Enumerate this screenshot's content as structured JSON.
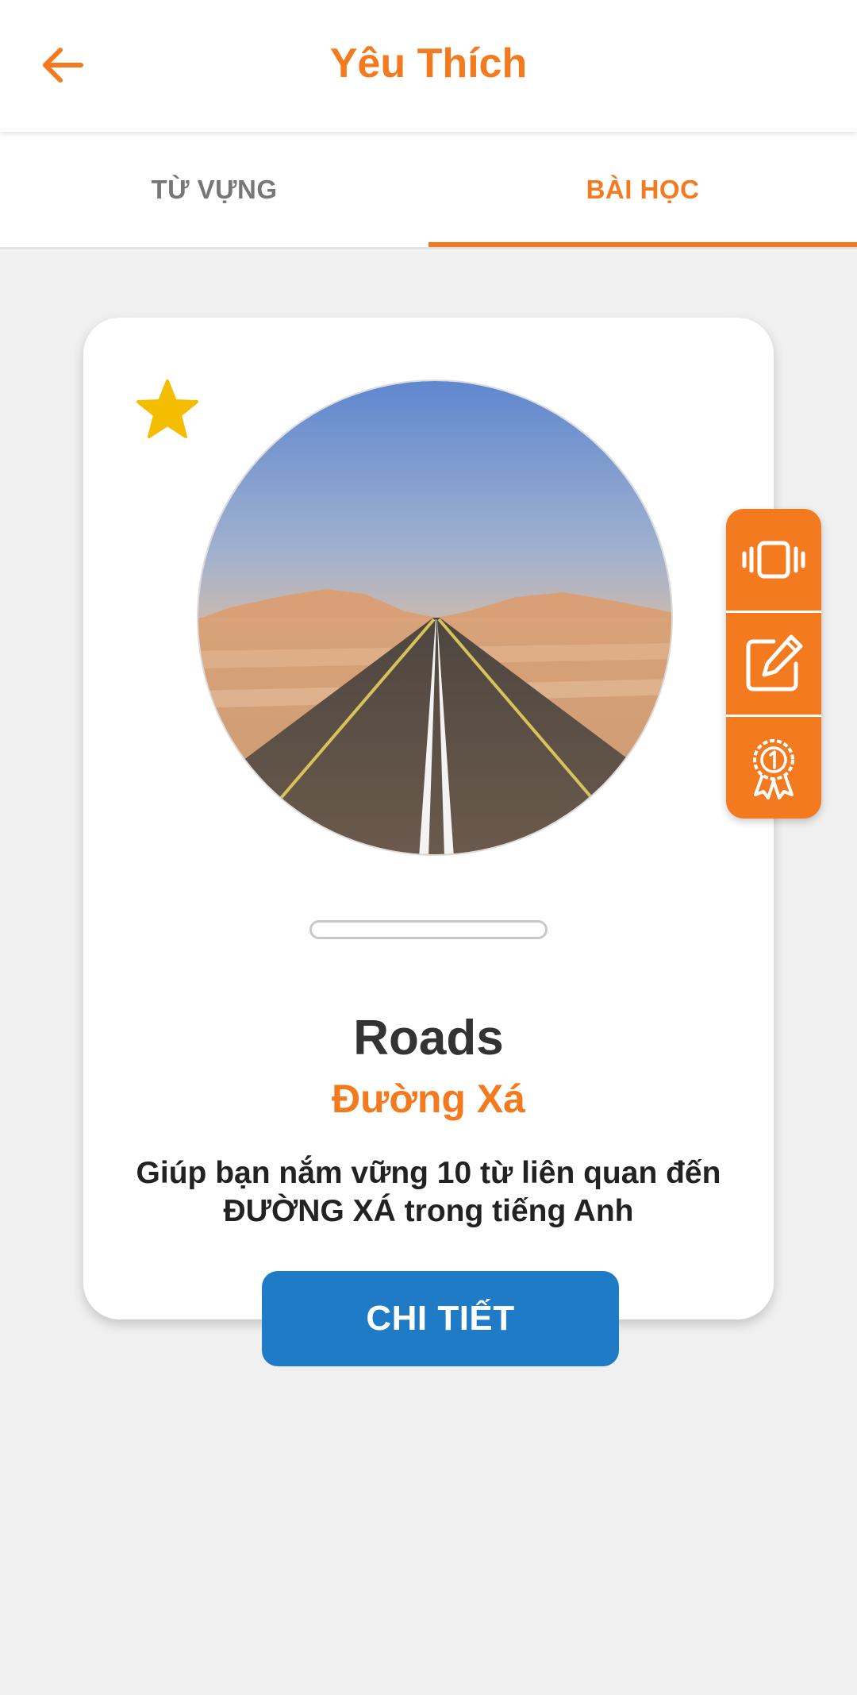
{
  "header": {
    "title": "Yêu Thích",
    "back_icon": "arrow-left-icon"
  },
  "tabs": [
    {
      "label": "TỪ VỰNG",
      "active": false
    },
    {
      "label": "BÀI HỌC",
      "active": true
    }
  ],
  "lesson": {
    "favorite": true,
    "favorite_icon": "star-icon",
    "image_subject": "desert road",
    "progress": 0,
    "title": "Roads",
    "subtitle": "Đường Xá",
    "description_line1": "Giúp bạn nắm vững 10 từ liên quan đến",
    "description_line2": "ĐƯỜNG XÁ trong tiếng Anh",
    "detail_button": "CHI TIẾT"
  },
  "side_actions": [
    {
      "icon": "vibrate-flashcard-icon"
    },
    {
      "icon": "edit-icon"
    },
    {
      "icon": "award-rank-icon"
    }
  ],
  "colors": {
    "accent": "#f47a20",
    "button_blue": "#1f7bc6",
    "star": "#f5bd00",
    "background": "#f0f0f0"
  }
}
